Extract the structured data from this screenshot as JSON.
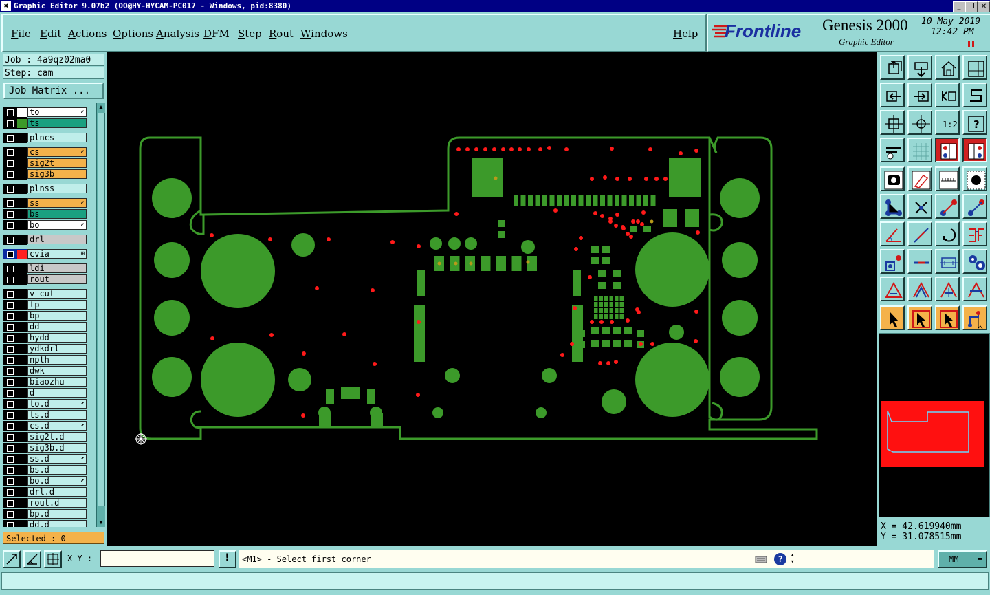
{
  "window": {
    "title": "Graphic Editor 9.07b2 (OO@HY-HYCAM-PC017 - Windows, pid:8380)",
    "buttons": [
      "_",
      "❐",
      "✕"
    ]
  },
  "menu": {
    "items": [
      "File",
      "Edit",
      "Actions",
      "Options",
      "Analysis",
      "DFM",
      "Step",
      "Rout",
      "Windows"
    ],
    "help": "Help"
  },
  "logo": {
    "brand": "Frontline",
    "product": "Genesis 2000",
    "subtitle": "Graphic Editor",
    "date": "10 May 2019",
    "time": "12:42 PM"
  },
  "job": {
    "job_label": "Job : 4a9qz02ma0",
    "step_label": "Step: cam",
    "matrix_button": "Job Matrix ..."
  },
  "layers": [
    {
      "name": "to",
      "bg": "#ffffff",
      "color": "#ffffff",
      "mark": "⬋"
    },
    {
      "name": "ts",
      "bg": "#1aa080",
      "color": "#3c9a2a",
      "mark": ""
    },
    {
      "name": "plncs",
      "bg": "#bfeeea",
      "color": "",
      "mark": ""
    },
    {
      "name": "cs",
      "bg": "#f4b24a",
      "color": "",
      "mark": "⬋"
    },
    {
      "name": "sig2t",
      "bg": "#f4b24a",
      "color": "",
      "mark": ""
    },
    {
      "name": "sig3b",
      "bg": "#f4b24a",
      "color": "",
      "mark": ""
    },
    {
      "name": "plnss",
      "bg": "#bfeeea",
      "color": "",
      "mark": ""
    },
    {
      "name": "ss",
      "bg": "#f4b24a",
      "color": "",
      "mark": "⬋"
    },
    {
      "name": "bs",
      "bg": "#1aa080",
      "color": "",
      "mark": ""
    },
    {
      "name": "bo",
      "bg": "#ffffff",
      "color": "",
      "mark": "⬋"
    },
    {
      "name": "drl",
      "bg": "#c8c8c8",
      "color": "",
      "mark": ""
    },
    {
      "name": "cvia",
      "bg": "#bfeeea",
      "color": "#ff2020",
      "mark": "⊞"
    },
    {
      "name": "ldi",
      "bg": "#c8c8c8",
      "color": "",
      "mark": ""
    },
    {
      "name": "rout",
      "bg": "#c8c8c8",
      "color": "",
      "mark": ""
    },
    {
      "name": "v-cut",
      "bg": "#bfeeea",
      "color": "",
      "mark": ""
    },
    {
      "name": "tp",
      "bg": "#bfeeea",
      "color": "",
      "mark": ""
    },
    {
      "name": "bp",
      "bg": "#bfeeea",
      "color": "",
      "mark": ""
    },
    {
      "name": "dd",
      "bg": "#bfeeea",
      "color": "",
      "mark": ""
    },
    {
      "name": "hydd",
      "bg": "#bfeeea",
      "color": "",
      "mark": ""
    },
    {
      "name": "ydkdrl",
      "bg": "#bfeeea",
      "color": "",
      "mark": ""
    },
    {
      "name": "npth",
      "bg": "#bfeeea",
      "color": "",
      "mark": ""
    },
    {
      "name": "dwk",
      "bg": "#bfeeea",
      "color": "",
      "mark": ""
    },
    {
      "name": "biaozhu",
      "bg": "#bfeeea",
      "color": "",
      "mark": ""
    },
    {
      "name": "d",
      "bg": "#bfeeea",
      "color": "",
      "mark": ""
    },
    {
      "name": "to.d",
      "bg": "#bfeeea",
      "color": "",
      "mark": "⬋"
    },
    {
      "name": "ts.d",
      "bg": "#bfeeea",
      "color": "",
      "mark": ""
    },
    {
      "name": "cs.d",
      "bg": "#bfeeea",
      "color": "",
      "mark": "⬋"
    },
    {
      "name": "sig2t.d",
      "bg": "#bfeeea",
      "color": "",
      "mark": ""
    },
    {
      "name": "sig3b.d",
      "bg": "#bfeeea",
      "color": "",
      "mark": ""
    },
    {
      "name": "ss.d",
      "bg": "#bfeeea",
      "color": "",
      "mark": "⬋"
    },
    {
      "name": "bs.d",
      "bg": "#bfeeea",
      "color": "",
      "mark": ""
    },
    {
      "name": "bo.d",
      "bg": "#bfeeea",
      "color": "",
      "mark": "⬋"
    },
    {
      "name": "drl.d",
      "bg": "#bfeeea",
      "color": "",
      "mark": ""
    },
    {
      "name": "rout.d",
      "bg": "#bfeeea",
      "color": "",
      "mark": ""
    },
    {
      "name": "bp.d",
      "bg": "#bfeeea",
      "color": "",
      "mark": ""
    },
    {
      "name": "dd.d",
      "bg": "#bfeeea",
      "color": "",
      "mark": ""
    }
  ],
  "selected": "Selected : 0",
  "toolbar_icons": [
    "zoom-extents-icon",
    "zoom-in-icon",
    "home-icon",
    "split-view-icon",
    "pan-left-icon",
    "pan-right-icon",
    "undo-view-icon",
    "snap-icon",
    "fit-vertical-icon",
    "fit-all-icon",
    "scale-1-2-icon",
    "help-query-icon",
    "measure-settings-icon",
    "grid-icon",
    "layer-view-1-icon",
    "layer-view-2-icon",
    "fill-pad-icon",
    "outline-icon",
    "ruler-icon",
    "pad-dot-icon",
    "net-connect-icon",
    "cross-delete-icon",
    "line-draw-icon",
    "line-add-icon",
    "angle-measure-icon",
    "line-edit-icon",
    "arc-icon",
    "font-icon",
    "pad-edit-icon",
    "cut-line-icon",
    "dimension-icon",
    "pad-cluster-icon",
    "triangle-1-icon",
    "triangle-2-icon",
    "triangle-3-icon",
    "triangle-4-icon",
    "select-pointer-icon",
    "select-box-icon",
    "select-orange-icon",
    "route-icon"
  ],
  "coords": {
    "x": "X = 42.619940mm",
    "y": "Y = 31.078515mm"
  },
  "bottom": {
    "xy_label": "X Y :",
    "xy_value": "",
    "bang": "!",
    "prompt": "<M1> - Select first corner",
    "unit": "MM"
  },
  "colors": {
    "board": "#3c9a2a",
    "via": "#ff1a1a",
    "outline": "#3c9a2a",
    "overview_fill": "#ff1010"
  }
}
